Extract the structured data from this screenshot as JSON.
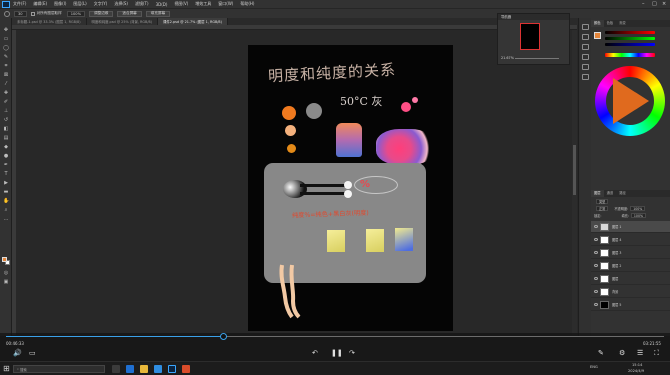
{
  "menubar": {
    "items": [
      "文件(F)",
      "编辑(E)",
      "图像(I)",
      "图层(L)",
      "文字(Y)",
      "选择(S)",
      "滤镜(T)",
      "3D(D)",
      "视图(V)",
      "增效工具",
      "窗口(W)",
      "帮助(H)"
    ]
  },
  "options": {
    "brush_size": "30",
    "check_all_layers": "对所有图层取样",
    "zoom_field": "100%",
    "enhance_edge": "调整边缘",
    "btn_fit": "适合屏幕",
    "btn_fill": "填充屏幕"
  },
  "tabs": [
    {
      "label": "未标题-1.psd @ 33.3% (图层 1, RGB/8)",
      "active": false
    },
    {
      "label": "明度和纯度.psd @ 25% (背景, RGB/8)",
      "active": false
    },
    {
      "label": "课件2.psd @ 21.7% (图层 1, RGB/8)",
      "active": true
    }
  ],
  "artwork": {
    "title_text": "明度和纯度的关系",
    "temp_text": "50°C 灰",
    "pct_text": "%",
    "formula_text": "纯度%=纯色+黑白灰(明度)"
  },
  "navigator": {
    "title": "导航器",
    "zoom": "21.67%"
  },
  "color_panel": {
    "tabs": [
      "颜色",
      "色板",
      "渐变"
    ],
    "fg_color": "#e3853a",
    "bg_color": "#ffffff"
  },
  "layers_panel": {
    "tabs": [
      "图层",
      "通道",
      "路径"
    ],
    "filter_label": "类型",
    "blend_mode": "正常",
    "opacity_label": "不透明度:",
    "opacity_value": "100%",
    "lock_label": "锁定:",
    "fill_label": "填充:",
    "fill_value": "100%",
    "layers": [
      {
        "name": "图层 1",
        "selected": true,
        "thumb": "#d7d7d7"
      },
      {
        "name": "图层 4",
        "selected": false,
        "thumb": "#ffffff"
      },
      {
        "name": "图层 3",
        "selected": false,
        "thumb": "#ffffff"
      },
      {
        "name": "图层 2",
        "selected": false,
        "thumb": "#ffffff"
      },
      {
        "name": "图层",
        "selected": false,
        "thumb": "#ffffff"
      },
      {
        "name": "背景",
        "selected": false,
        "thumb": "#ffffff"
      },
      {
        "name": "图层 5",
        "selected": false,
        "thumb": "#000000"
      }
    ]
  },
  "player": {
    "elapsed": "00:46:33",
    "duration": "03:21:55",
    "progress_fraction": 0.33
  },
  "taskbar": {
    "search_placeholder": "搜索",
    "tray_text": "ENG",
    "clock_time": "15:14",
    "clock_date": "2024/4/9"
  }
}
